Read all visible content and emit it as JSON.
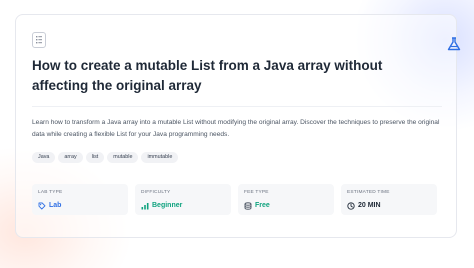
{
  "lab": {
    "title": "How to create a mutable List from a Java array without affecting the original array",
    "description": "Learn how to transform a Java array into a mutable List without modifying the original array. Discover the techniques to preserve the original data while creating a flexible List for your Java programming needs.",
    "tags": [
      "Java",
      "array",
      "list",
      "mutable",
      "immutable"
    ],
    "stats": [
      {
        "label": "LAB TYPE",
        "value": "Lab",
        "icon": "tag-icon",
        "color": "#2f6fe4"
      },
      {
        "label": "DIFFICULTY",
        "value": "Beginner",
        "icon": "signal-bars-icon",
        "color": "#10a37f"
      },
      {
        "label": "FEE TYPE",
        "value": "Free",
        "icon": "coins-icon",
        "color": "#10a37f"
      },
      {
        "label": "ESTIMATED TIME",
        "value": "20 MIN",
        "icon": "clock-icon",
        "color": "#1f2937"
      }
    ]
  },
  "colors": {
    "accent_blue": "#2f6fe4",
    "accent_green": "#10a37f",
    "text_dark": "#1f2937"
  }
}
